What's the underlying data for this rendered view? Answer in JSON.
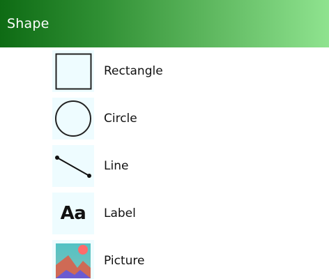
{
  "panel": {
    "header": {
      "title": "Shape",
      "gradient_start": "#0e6b14",
      "gradient_end": "#8fe38f"
    },
    "items": [
      {
        "label": "Rectangle",
        "icon": "rectangle-icon"
      },
      {
        "label": "Circle",
        "icon": "circle-icon"
      },
      {
        "label": "Line",
        "icon": "line-icon"
      },
      {
        "label": "Label",
        "icon": "label-icon",
        "glyph": "Aa"
      },
      {
        "label": "Picture",
        "icon": "picture-icon"
      }
    ],
    "icon_background": "#eefcff"
  }
}
